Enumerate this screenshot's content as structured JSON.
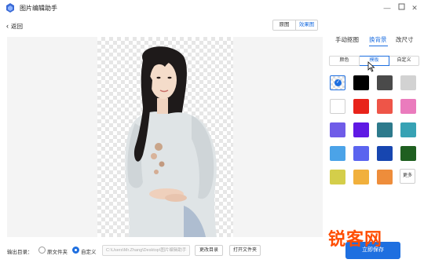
{
  "titlebar": {
    "title": "图片编辑助手"
  },
  "toolbar": {
    "back_label": "返回",
    "compare": {
      "original_label": "原图",
      "result_label": "效果图"
    }
  },
  "side_panel": {
    "tabs": [
      {
        "label": "手动抠图",
        "active": false
      },
      {
        "label": "换背景",
        "active": true
      },
      {
        "label": "改尺寸",
        "active": false
      }
    ],
    "segments": [
      {
        "label": "颜色",
        "active": false
      },
      {
        "label": "模板",
        "active": true
      },
      {
        "label": "自定义",
        "active": false
      }
    ],
    "swatches": [
      [
        "transparent",
        "#000000",
        "#4a4a4a",
        "#d2d2d2"
      ],
      [
        "#ffffff",
        "#e8231a",
        "#ee5548",
        "#ea7bbd"
      ],
      [
        "#6f5ce8",
        "#5f19e4",
        "#2d7a8c",
        "#37a2b4"
      ],
      [
        "#4ba3e8",
        "#5b64ef",
        "#1746b0",
        "#1f5f20"
      ],
      [
        "#d4ce4a",
        "#f1b03c",
        "#ee8d3b"
      ]
    ],
    "more_label": "更多",
    "accent_color": "#1e6fe0"
  },
  "bottom_bar": {
    "output_label": "输出目录：",
    "radio_original_label": "原文件夹",
    "radio_custom_label": "自定义",
    "path_value": "C:\\Users\\Mr.Zhang\\Desktop\\图片编辑助手",
    "change_dir_label": "更改目录",
    "open_folder_label": "打开文件夹",
    "save_label": "立即保存"
  },
  "watermark": {
    "text": "锐客网"
  }
}
